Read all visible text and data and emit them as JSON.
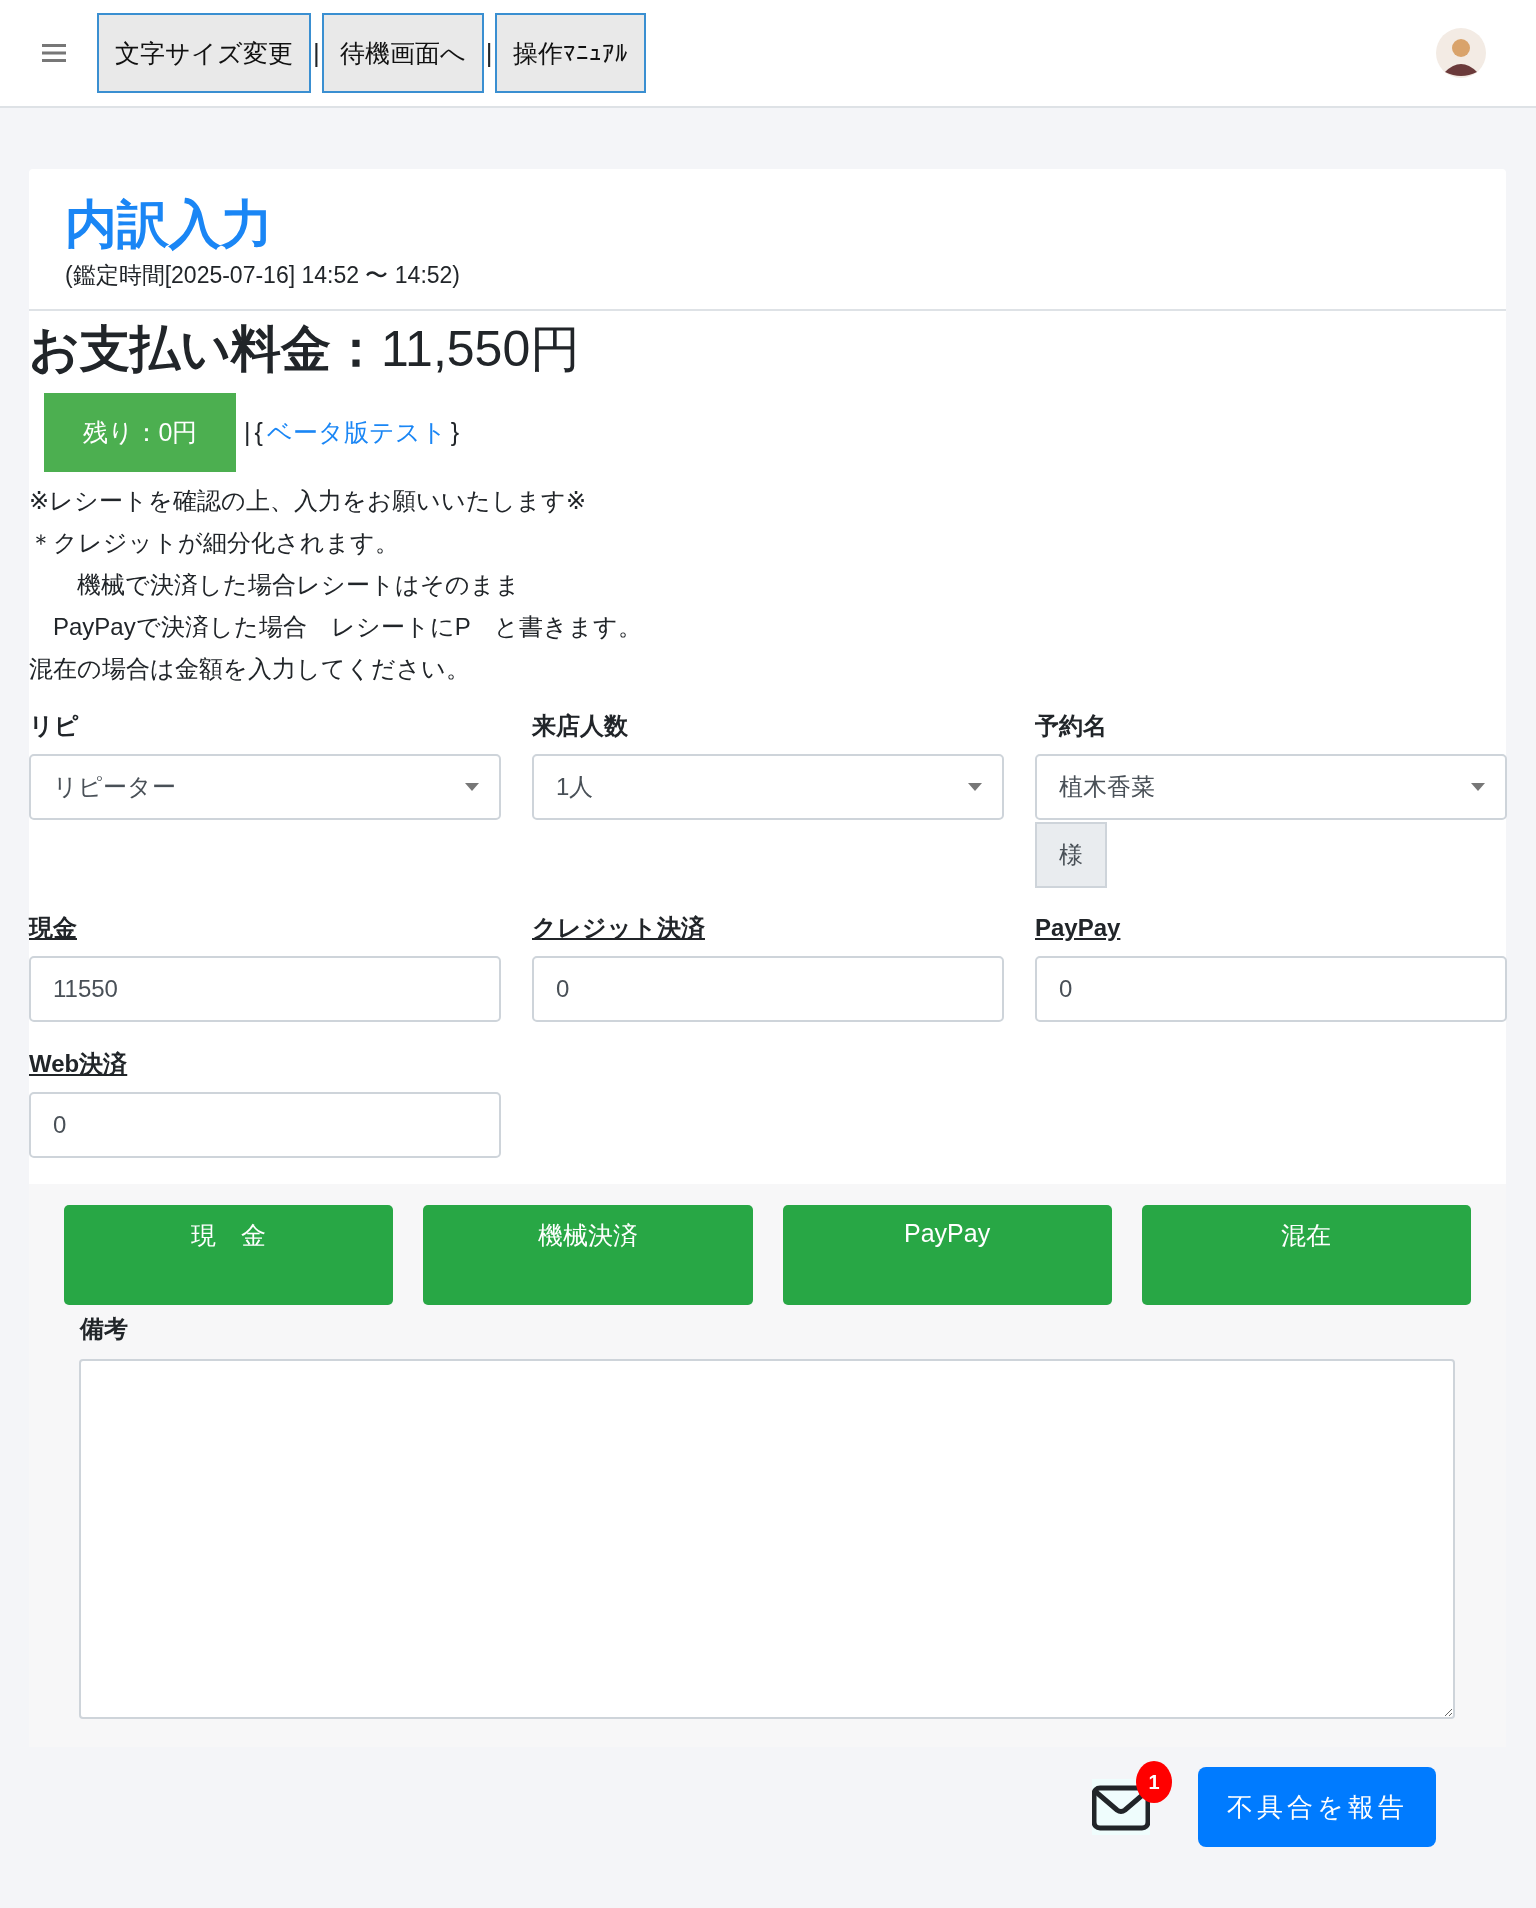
{
  "nav": {
    "buttons": [
      "文字サイズ変更",
      "待機画面へ",
      "操作ﾏﾆｭｱﾙ"
    ],
    "separator": "|"
  },
  "page": {
    "title": "内訳入力",
    "subtitle": "(鑑定時間[2025-07-16] 14:52 〜 14:52)"
  },
  "payment": {
    "heading": "お支払い料金：",
    "amount": "11,550円"
  },
  "remaining": {
    "label": "残り：0円",
    "separator": "|",
    "brace_open": "{",
    "link": "ベータ版テスト",
    "brace_close": "}"
  },
  "notes": [
    "※レシートを確認の上、入力をお願いいたします※",
    "＊クレジットが細分化されます。",
    "　　機械で決済した場合レシートはそのまま",
    "　PayPayで決済した場合　レシートにP　と書きます。",
    "混在の場合は金額を入力してください。"
  ],
  "selects": [
    {
      "label": "リピ",
      "value": "リピーター"
    },
    {
      "label": "来店人数",
      "value": "1人"
    },
    {
      "label": "予約名",
      "value": "植木香菜",
      "suffix": "様"
    }
  ],
  "amounts": [
    {
      "label": "現金",
      "value": "11550"
    },
    {
      "label": "クレジット決済",
      "value": "0"
    },
    {
      "label": "PayPay",
      "value": "0"
    },
    {
      "label": "Web決済",
      "value": "0"
    }
  ],
  "pay_buttons": [
    "現　金",
    "機械決済",
    "PayPay",
    "混在"
  ],
  "remarks": {
    "label": "備考"
  },
  "footer": {
    "mail_count": "1",
    "report_button": "不具合を報告"
  }
}
